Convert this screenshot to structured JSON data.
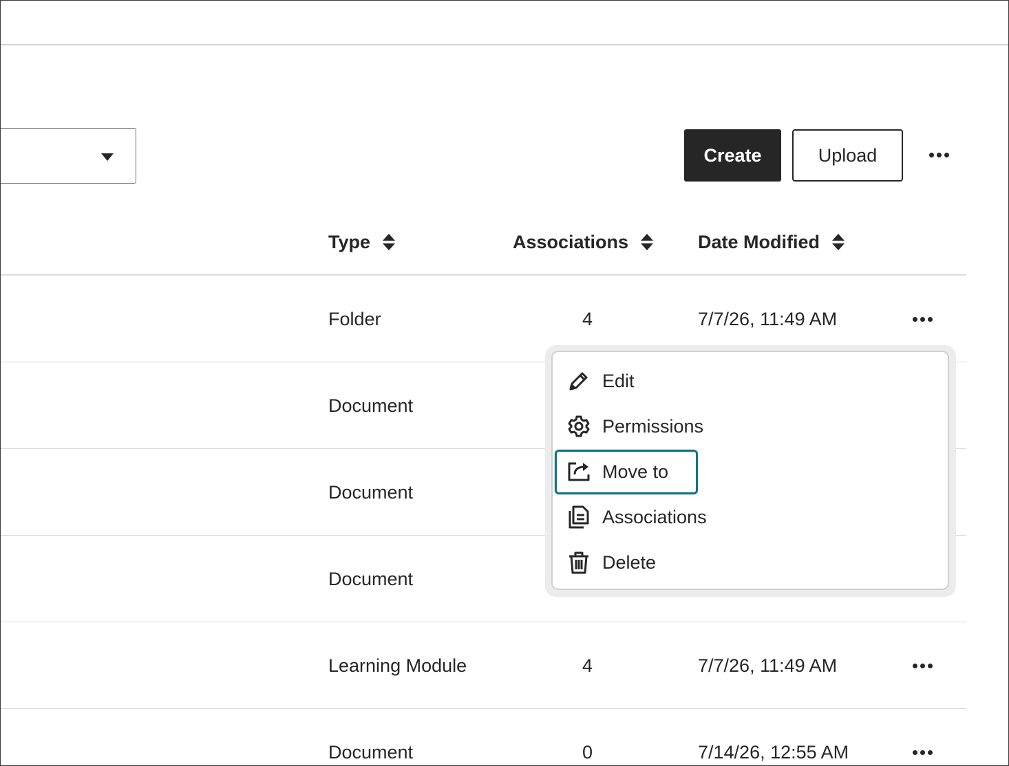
{
  "toolbar": {
    "create_label": "Create",
    "upload_label": "Upload"
  },
  "table": {
    "columns": [
      {
        "label": "Type"
      },
      {
        "label": "Associations"
      },
      {
        "label": "Date Modified"
      }
    ],
    "rows": [
      {
        "type": "Folder",
        "associations": "4",
        "date": "7/7/26, 11:49 AM"
      },
      {
        "type": "Document",
        "associations": "",
        "date": ""
      },
      {
        "type": "Document",
        "associations": "",
        "date": ""
      },
      {
        "type": "Document",
        "associations": "",
        "date": ""
      },
      {
        "type": "Learning Module",
        "associations": "4",
        "date": "7/7/26, 11:49 AM"
      },
      {
        "type": "Document",
        "associations": "0",
        "date": "7/14/26, 12:55 AM"
      }
    ]
  },
  "context_menu": {
    "items": [
      {
        "label": "Edit",
        "icon": "pencil-icon"
      },
      {
        "label": "Permissions",
        "icon": "gear-icon"
      },
      {
        "label": "Move to",
        "icon": "move-to-icon"
      },
      {
        "label": "Associations",
        "icon": "associations-icon"
      },
      {
        "label": "Delete",
        "icon": "trash-icon"
      }
    ],
    "focused_item": "Move to",
    "focus_color": "#0f7585"
  },
  "colors": {
    "primary_button": "#262626",
    "text": "#262626",
    "divider": "#d9d9d9"
  }
}
